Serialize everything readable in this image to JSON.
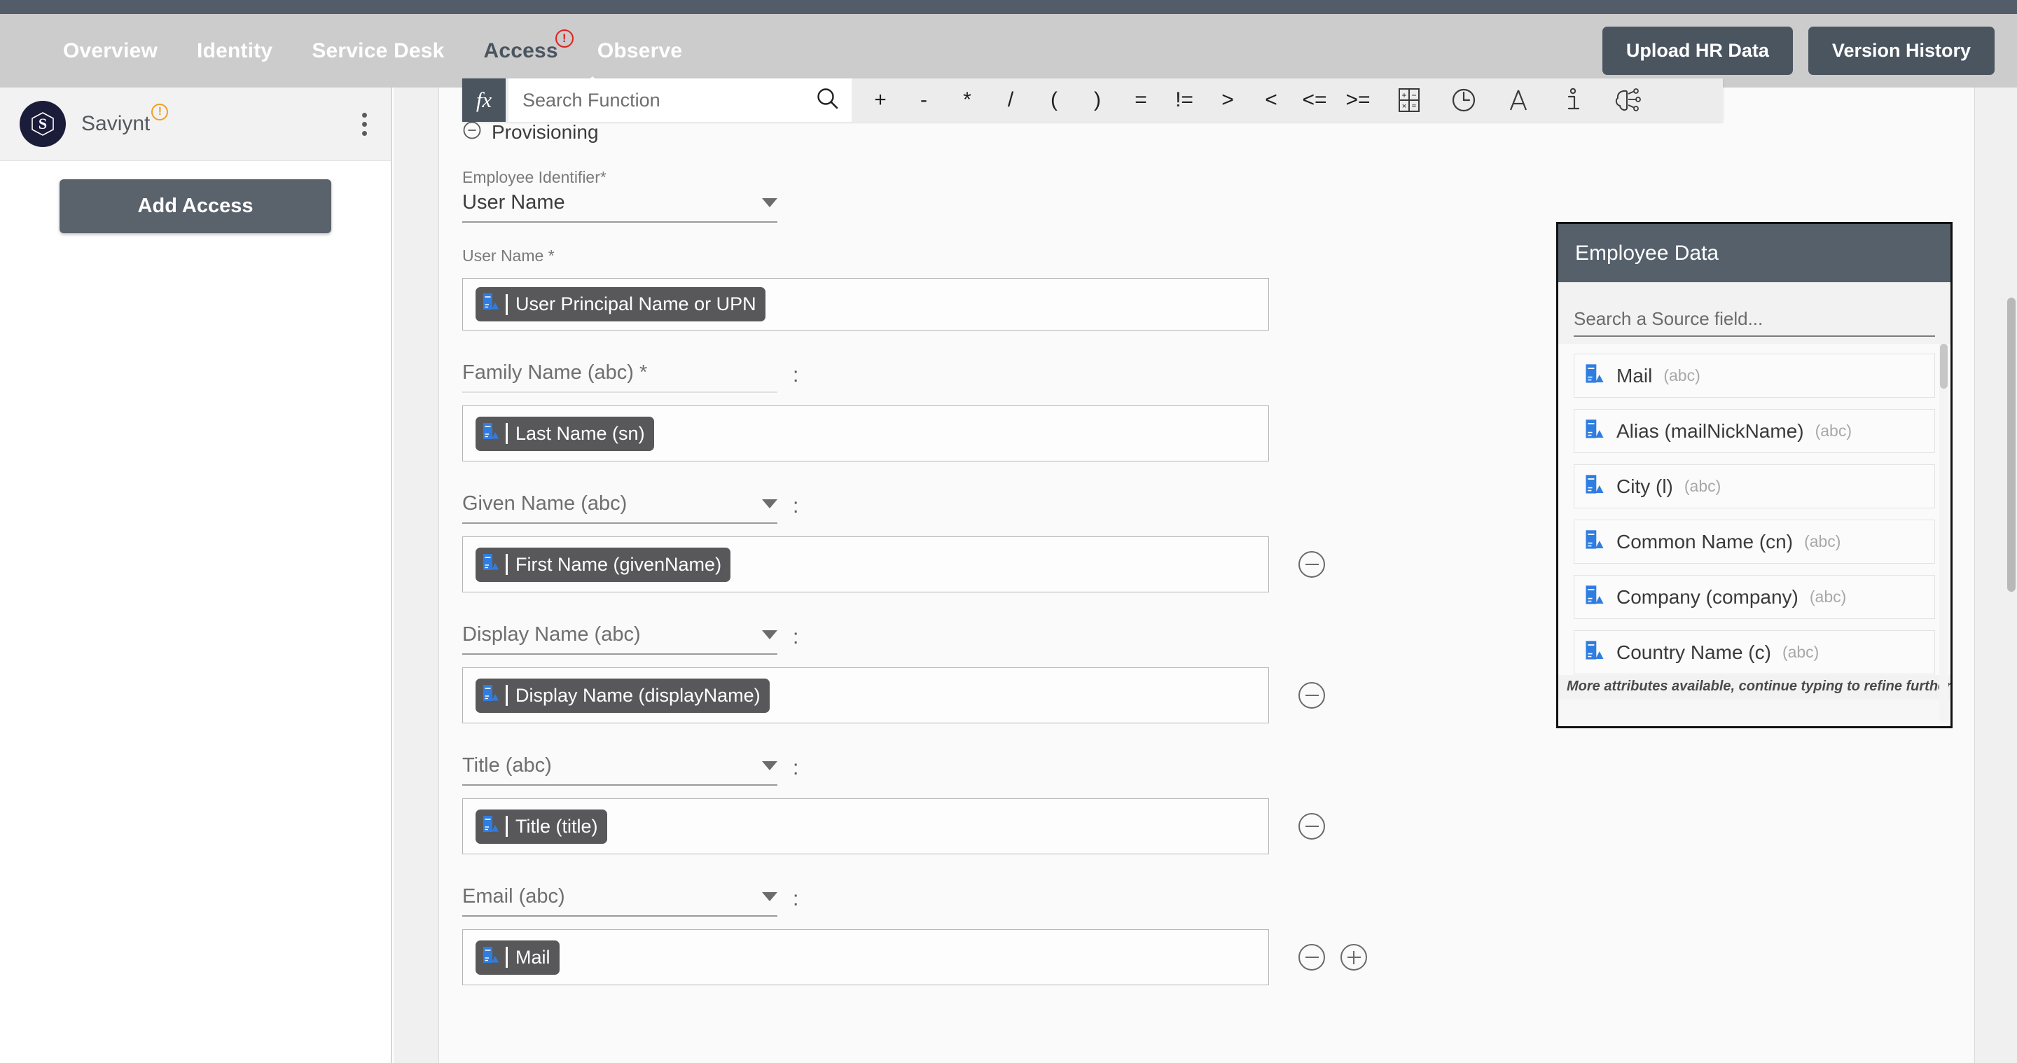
{
  "header": {
    "nav_items": [
      {
        "label": "Overview",
        "active": false,
        "badge": null
      },
      {
        "label": "Identity",
        "active": false,
        "badge": null
      },
      {
        "label": "Service Desk",
        "active": false,
        "badge": null
      },
      {
        "label": "Access",
        "active": true,
        "badge": "!"
      },
      {
        "label": "Observe",
        "active": false,
        "badge": null
      }
    ],
    "upload_button": "Upload HR Data",
    "version_button": "Version History"
  },
  "sidebar": {
    "app_name": "Saviynt",
    "app_warning_badge": "!",
    "logo_letter": "S",
    "add_access_button": "Add Access"
  },
  "toolbar": {
    "fx_label": "fx",
    "search_placeholder": "Search Function",
    "search_value": "",
    "operators": [
      "+",
      "-",
      "*",
      "/",
      "(",
      ")",
      "=",
      "!=",
      ">",
      "<",
      "<=",
      ">="
    ],
    "icons": [
      "calculator-icon",
      "clock-icon",
      "text-format-icon",
      "info-icon",
      "ai-brain-icon"
    ]
  },
  "section": {
    "title": "Provisioning",
    "collapse_icon": "minus-circle-icon"
  },
  "form": {
    "employee_identifier": {
      "label": "Employee Identifier*",
      "value": "User Name"
    },
    "fields": [
      {
        "label": "User Name *",
        "has_caret": false,
        "has_colon": false,
        "has_underline": false,
        "chip": "User Principal Name or UPN",
        "controls": []
      },
      {
        "label": "Family Name (abc) *",
        "has_caret": false,
        "has_colon": true,
        "has_underline": true,
        "chip": "Last Name (sn)",
        "controls": []
      },
      {
        "label": "Given Name (abc)",
        "has_caret": true,
        "has_colon": true,
        "has_underline": true,
        "chip": "First Name (givenName)",
        "controls": [
          "minus"
        ]
      },
      {
        "label": "Display Name (abc)",
        "has_caret": true,
        "has_colon": true,
        "has_underline": true,
        "chip": "Display Name (displayName)",
        "controls": [
          "minus"
        ]
      },
      {
        "label": "Title (abc)",
        "has_caret": true,
        "has_colon": true,
        "has_underline": true,
        "chip": "Title (title)",
        "controls": [
          "minus"
        ]
      },
      {
        "label": "Email (abc)",
        "has_caret": true,
        "has_colon": true,
        "has_underline": true,
        "chip": "Mail",
        "controls": [
          "minus",
          "plus"
        ]
      }
    ]
  },
  "employee_panel": {
    "title": "Employee Data",
    "search_placeholder": "Search a Source field...",
    "search_value": "",
    "items": [
      {
        "label": "Mail",
        "type": "(abc)"
      },
      {
        "label": "Alias (mailNickName)",
        "type": "(abc)"
      },
      {
        "label": "City (l)",
        "type": "(abc)"
      },
      {
        "label": "Common Name (cn)",
        "type": "(abc)"
      },
      {
        "label": "Company (company)",
        "type": "(abc)"
      },
      {
        "label": "Country Name (c)",
        "type": "(abc)"
      }
    ],
    "footer_note": "More attributes available, continue typing to refine further."
  },
  "colors": {
    "nav_bg": "#cccccc",
    "dark_strip": "#525d69",
    "accent_dark": "#4b5560",
    "chip_bg": "#58585b",
    "chip_icon_blue": "#2f7de1",
    "warning_orange": "#f0a020",
    "error_red": "#e02020"
  }
}
